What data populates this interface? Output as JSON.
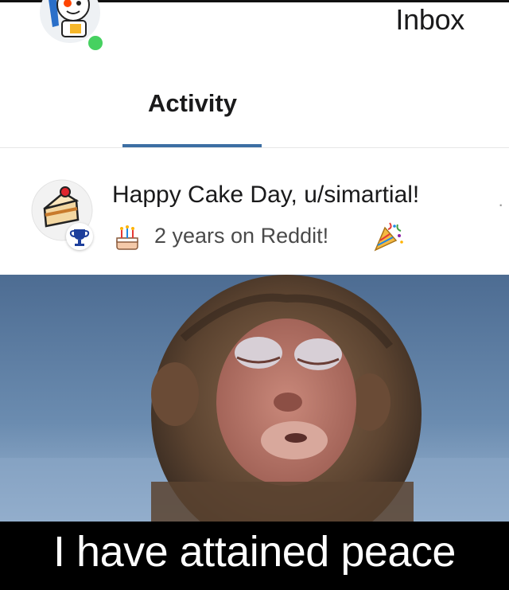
{
  "header": {
    "title": "Inbox",
    "online_status_color": "#46d160"
  },
  "tabs": [
    {
      "label": "Activity",
      "active": true
    }
  ],
  "notification": {
    "icon": "cake-trophy-icon",
    "title": "Happy Cake Day, u/simartial!",
    "subtitle": "2 years on Reddit!",
    "subtitle_prefix_icon": "birthday-cake-emoji",
    "subtitle_suffix_icon": "party-popper-emoji",
    "badge_icon": "trophy-icon"
  },
  "meme": {
    "image": "monkey-eyes-closed-photo",
    "caption": "I have attained peace"
  },
  "colors": {
    "tab_underline": "#3c6ea3",
    "caption_bg": "#000000",
    "caption_text": "#ffffff"
  }
}
